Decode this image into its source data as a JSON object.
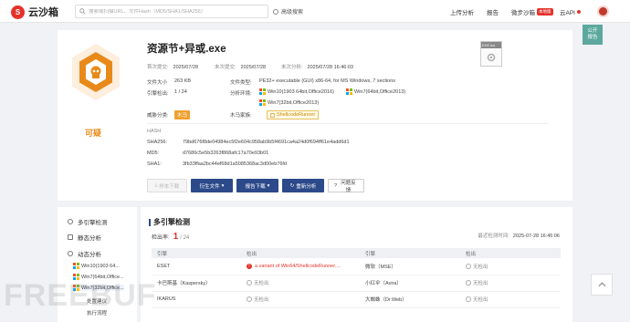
{
  "header": {
    "brand_mark": "S",
    "brand": "云沙箱",
    "search_placeholder": "搜索或扫描URL、文件Hash（MD5/SHA1/SHA256）",
    "advanced_search": "高级搜索",
    "upload": "上传分析",
    "report": "报告",
    "desktop_sandbox": "微步沙箱",
    "desktop_badge": "本地版",
    "cloud_api": "云API",
    "floating_report": [
      "公开",
      "报告"
    ]
  },
  "file": {
    "name": "资源节+异或.exe",
    "verdict": "可疑",
    "first_submitted_label": "首次提交:",
    "first_submitted": "2025/07/28",
    "last_submitted_label": "末次提交:",
    "last_submitted": "2025/07/28",
    "last_analyzed_label": "末次分析:",
    "last_analyzed": "2025/07/28 16:46:03",
    "size_label": "文件大小",
    "size": "263 KB",
    "type_label": "文件类型:",
    "type": "PE32+ executable (GUI) x86-64, for MS Windows, 7 sections",
    "detection_label": "引擎检出:",
    "detection": "1 / 24",
    "env_label": "分析环境:",
    "environments": [
      "Win10(1903 64bit,Office2016)",
      "Win7(64bit,Office2013)",
      "Win7(32bit,Office2013)"
    ],
    "threat_label": "威胁分类:",
    "threat_tag": "木马",
    "family_label": "木马家族:",
    "family_tag": "ShellcodeRunner",
    "file_icon_label": "EXE.ico",
    "hash_heading": "HASH",
    "sha256_label": "SHA256:",
    "sha256": "79bd676f8de04984ec5f2e604c958ab9b5f4691ca4a24d0f694ff61e4add6d1",
    "md5_label": "MD5:",
    "md5": "d7686c5e5b3263f868afc17a70e93b01",
    "sha1_label": "SHA1:",
    "sha1": "3fb33ffaa2bc44ef68d1a5085368ac3d00eb76fd"
  },
  "actions": {
    "download_sample": "样本下载",
    "derived_files": "衍生文件",
    "report_download": "报告下载",
    "reanalyze": "重新分析",
    "feedback": "问题反馈"
  },
  "sidebar": {
    "engine_detection": "多引擎检测",
    "static_analysis": "静态分析",
    "dynamic_analysis": "动态分析",
    "env_items": [
      "Win10(1903 64...",
      "Win7(64bit,Office...",
      "Win7(32bit,Office..."
    ],
    "leaf_items": [
      "处置建议",
      "执行流程"
    ]
  },
  "engines": {
    "title": "多引擎检测",
    "rate_label": "检出率:",
    "rate_num": "1",
    "rate_den": "/ 24",
    "scan_time_label": "最近检测时间:",
    "scan_time": "2025-07-28 16:45:06",
    "columns": [
      "引擎",
      "检出",
      "引擎",
      "检出"
    ],
    "rows": [
      {
        "e1": "ESET",
        "r1": "a variant of Win64/ShellcodeRunner....",
        "d1": true,
        "e2": "微软（MSE）",
        "r2": "无检出"
      },
      {
        "e1": "卡巴斯基（Kaspersky）",
        "r1": "无检出",
        "d1": false,
        "e2": "小红伞（Avira）",
        "r2": "无检出"
      },
      {
        "e1": "IKARUS",
        "r1": "无检出",
        "d1": false,
        "e2": "大蜘蛛（Dr.Web）",
        "r2": "无检出"
      }
    ]
  },
  "watermark": "FREEBUF",
  "colors": {
    "brand_red": "#e4322b",
    "primary_blue": "#2c4a8a",
    "verdict_orange": "#e88a1a"
  }
}
